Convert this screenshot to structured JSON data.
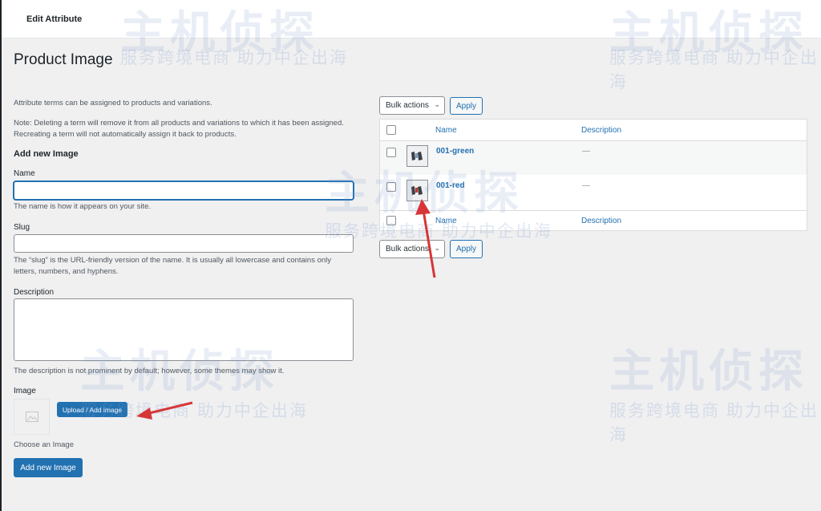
{
  "breadcrumb": "Edit Attribute",
  "page_title": "Product Image",
  "form": {
    "intro": "Attribute terms can be assigned to products and variations.",
    "note_line1": "Note: Deleting a term will remove it from all products and variations to which it has been assigned.",
    "note_line2": "Recreating a term will not automatically assign it back to products.",
    "heading": "Add new Image",
    "name_label": "Name",
    "name_value": "",
    "name_help": "The name is how it appears on your site.",
    "slug_label": "Slug",
    "slug_value": "",
    "slug_help_line1": "The “slug” is the URL-friendly version of the name. It is usually all lowercase and contains only",
    "slug_help_line2": "letters, numbers, and hyphens.",
    "description_label": "Description",
    "description_value": "",
    "description_help": "The description is not prominent by default; however, some themes may show it.",
    "image_label": "Image",
    "upload_button": "Upload / Add image",
    "choose_text": "Choose an Image",
    "submit_button": "Add new Image"
  },
  "table": {
    "bulk_top": "Bulk actions",
    "apply_top": "Apply",
    "bulk_bottom": "Bulk actions",
    "apply_bottom": "Apply",
    "col_name": "Name",
    "col_description": "Description",
    "rows": [
      {
        "name": "001-green",
        "description": "—"
      },
      {
        "name": "001-red",
        "description": "—"
      }
    ]
  },
  "watermark": {
    "logo_text": "主机侦探",
    "slogan": "服务跨境电商  助力中企出海"
  },
  "colors": {
    "accent": "#2271b1",
    "annotation_arrow": "#d63638"
  }
}
